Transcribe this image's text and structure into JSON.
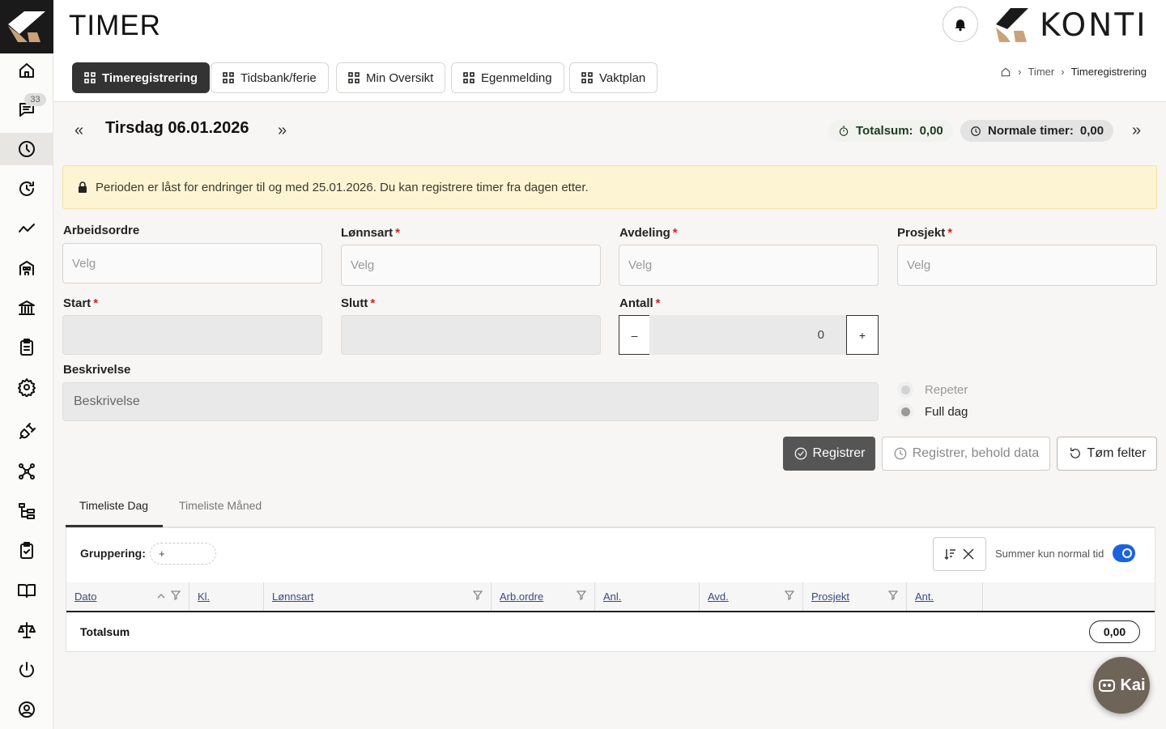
{
  "header": {
    "title": "TIMER",
    "brand": "KONTI"
  },
  "sidebar": {
    "messages_badge": "33"
  },
  "tabs": [
    {
      "label": "Timeregistrering",
      "active": true
    },
    {
      "label": "Tidsbank/ferie"
    },
    {
      "label": "Min Oversikt"
    },
    {
      "label": "Egenmelding"
    },
    {
      "label": "Vaktplan"
    }
  ],
  "breadcrumb": {
    "items": [
      "Timer",
      "Timeregistrering"
    ]
  },
  "date_nav": {
    "date": "Tirsdag 06.01.2026",
    "totalsum_label": "Totalsum:",
    "totalsum_value": "0,00",
    "normal_label": "Normale timer:",
    "normal_value": "0,00"
  },
  "alert": {
    "text": "Perioden er låst for endringer til og med 25.01.2026. Du kan registrere timer fra dagen etter."
  },
  "form": {
    "arbeidsordre": {
      "label": "Arbeidsordre",
      "placeholder": "Velg"
    },
    "lonnsart": {
      "label": "Lønnsart",
      "placeholder": "Velg"
    },
    "avdeling": {
      "label": "Avdeling",
      "placeholder": "Velg"
    },
    "prosjekt": {
      "label": "Prosjekt",
      "placeholder": "Velg"
    },
    "start": {
      "label": "Start"
    },
    "slutt": {
      "label": "Slutt"
    },
    "antall": {
      "label": "Antall",
      "value": "0",
      "minus": "–",
      "plus": "+"
    },
    "beskrivelse": {
      "label": "Beskrivelse",
      "placeholder": "Beskrivelse"
    },
    "repeter": "Repeter",
    "full_dag": "Full dag",
    "required_mark": "*"
  },
  "buttons": {
    "register": "Registrer",
    "register_keep": "Registrer, behold data",
    "clear": "Tøm felter"
  },
  "subtabs": [
    "Timeliste Dag",
    "Timeliste Måned"
  ],
  "table": {
    "grouping_label": "Gruppering:",
    "grouping_add": "+",
    "sum_normal_label": "Summer kun normal tid",
    "columns": [
      "Dato",
      "Kl.",
      "Lønnsart",
      "Arb.ordre",
      "Anl.",
      "Avd.",
      "Prosjekt",
      "Ant."
    ],
    "total_label": "Totalsum",
    "total_value": "0,00"
  },
  "assistant": {
    "label": "Kai"
  },
  "colors": {
    "primary_dark": "#333333",
    "toggle": "#1a62e0",
    "alert_bg": "#fdf4d3",
    "required": "#d42020"
  }
}
